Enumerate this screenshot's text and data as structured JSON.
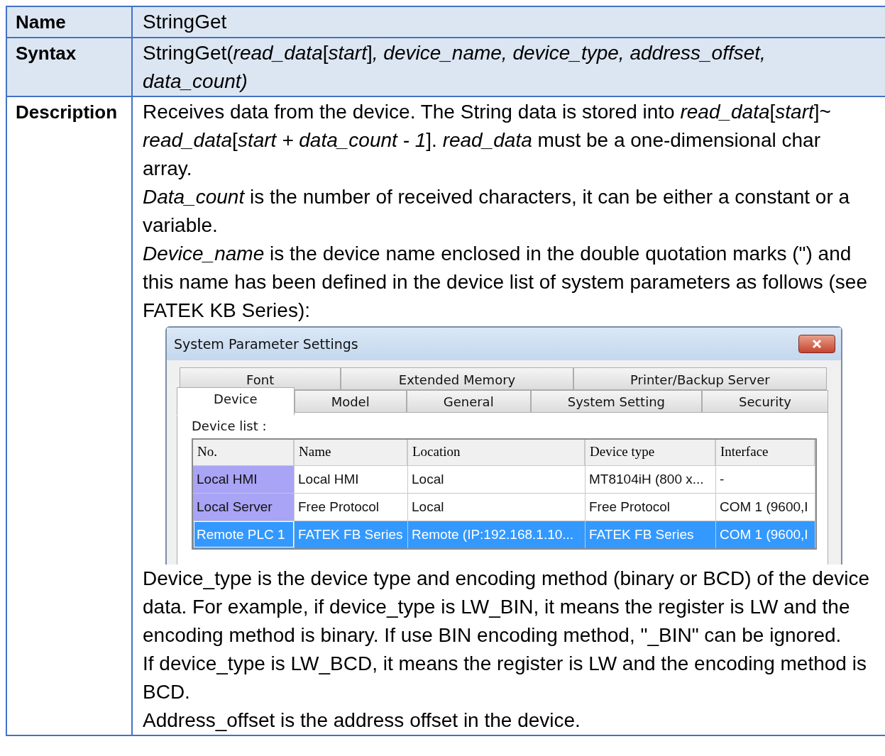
{
  "table": {
    "rows": [
      {
        "kind": "plain",
        "header": "Name",
        "paragraphs": [
          "StringGet"
        ]
      },
      {
        "kind": "plain",
        "header": "Syntax",
        "paragraphs": [
          "StringGet(*read_data*[*start*]*, device_name, device_type, address_offset, data_count)*"
        ]
      },
      {
        "kind": "description",
        "header": "Description",
        "paragraphs": [
          "Receives data from the device. The String data is stored into *read_data*[*start*]~ *read_data*[*start + data_count - 1*]. *read_data* must be a one-dimensional char array.",
          "*Data_count* is the number of received characters, it can be either a constant or a variable.",
          "*Device_name* is the device name enclosed in the double quotation marks (\") and this name has been defined in the device list of system parameters as follows (see FATEK KB Series):"
        ],
        "dialog": {
          "title": "System Parameter Settings",
          "tab_rows": [
            [
              {
                "label": "Font",
                "selected": false
              },
              {
                "label": "Extended Memory",
                "selected": false
              },
              {
                "label": "Printer/Backup Server",
                "selected": false
              }
            ],
            [
              {
                "label": "Device",
                "selected": true
              },
              {
                "label": "Model",
                "selected": false
              },
              {
                "label": "General",
                "selected": false
              },
              {
                "label": "System Setting",
                "selected": false
              },
              {
                "label": "Security",
                "selected": false
              }
            ]
          ],
          "list_label": "Device list :",
          "columns": [
            "No.",
            "Name",
            "Location",
            "Device type",
            "Interface"
          ],
          "rows": [
            {
              "selected": false,
              "cells": [
                "Local HMI",
                "Local HMI",
                "Local",
                "MT8104iH (800 x...",
                "-"
              ]
            },
            {
              "selected": false,
              "cells": [
                "Local Server",
                "Free Protocol",
                "Local",
                "Free Protocol",
                "COM 1 (9600,I"
              ]
            },
            {
              "selected": true,
              "cells": [
                "Remote PLC 1",
                "FATEK FB Series",
                "Remote (IP:192.168.1.10...",
                "FATEK FB Series",
                "COM 1 (9600,I"
              ]
            }
          ]
        },
        "after": [
          "Device_type is the device type and encoding method (binary or BCD) of the device data. For example, if device_type is LW_BIN, it means the register is LW and the encoding method is binary. If use BIN encoding method, \"_BIN\" can be ignored.",
          "If device_type is LW_BCD, it means the register is LW and the encoding method is BCD.",
          "Address_offset is the address offset in the device."
        ]
      }
    ]
  }
}
